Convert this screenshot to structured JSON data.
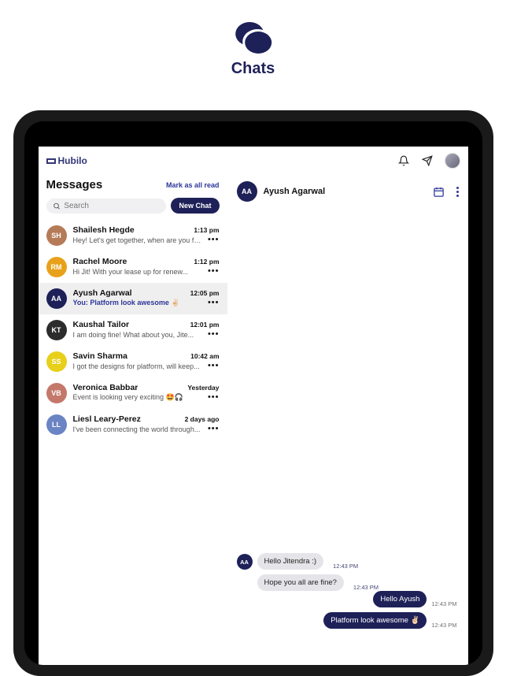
{
  "brand": {
    "title": "Chats"
  },
  "app": {
    "logo_text": "Hubilo",
    "header": {
      "title": "Messages",
      "mark_all": "Mark as all read",
      "search_placeholder": "Search",
      "new_chat": "New Chat"
    },
    "conversations": [
      {
        "initials": "SH",
        "bg": "#b57b58",
        "name": "Shailesh Hegde",
        "preview": "Hey! Let's get together, when are you fre...",
        "time": "1:13 pm"
      },
      {
        "initials": "RM",
        "bg": "#e8a11a",
        "name": "Rachel Moore",
        "preview": "Hi Jit! With your lease up for renew...",
        "time": "1:12 pm"
      },
      {
        "initials": "AA",
        "bg": "#1e2158",
        "name": "Ayush Agarwal",
        "preview": "You: Platform look awesome ✌🏻",
        "time": "12:05 pm",
        "selected": true
      },
      {
        "initials": "KT",
        "bg": "#2c2c2c",
        "name": "Kaushal Tailor",
        "preview": "I am doing fine! What about you, Jite...",
        "time": "12:01 pm"
      },
      {
        "initials": "SS",
        "bg": "#e8cf1a",
        "name": "Savin Sharma",
        "preview": "I got the designs for platform, will keep...",
        "time": "10:42 am"
      },
      {
        "initials": "VB",
        "bg": "#c4786a",
        "name": "Veronica Babbar",
        "preview": "Event is looking very exciting 🤩🎧",
        "time": "Yesterday"
      },
      {
        "initials": "LL",
        "bg": "#6a84c4",
        "name": "Liesl Leary-Perez",
        "preview": "I've been connecting the world through...",
        "time": "2 days ago"
      }
    ],
    "active_chat": {
      "initials": "AA",
      "name": "Ayush Agarwal",
      "messages_left": [
        {
          "text": "Hello Jitendra :)",
          "time": "12:43 PM"
        },
        {
          "text": "Hope you all are fine?",
          "time": "12:43 PM"
        }
      ],
      "messages_right": [
        {
          "text": "Hello Ayush",
          "time": "12:43 PM"
        },
        {
          "text": "Platform look awesome ✌🏻",
          "time": "12:43 PM"
        }
      ]
    }
  }
}
